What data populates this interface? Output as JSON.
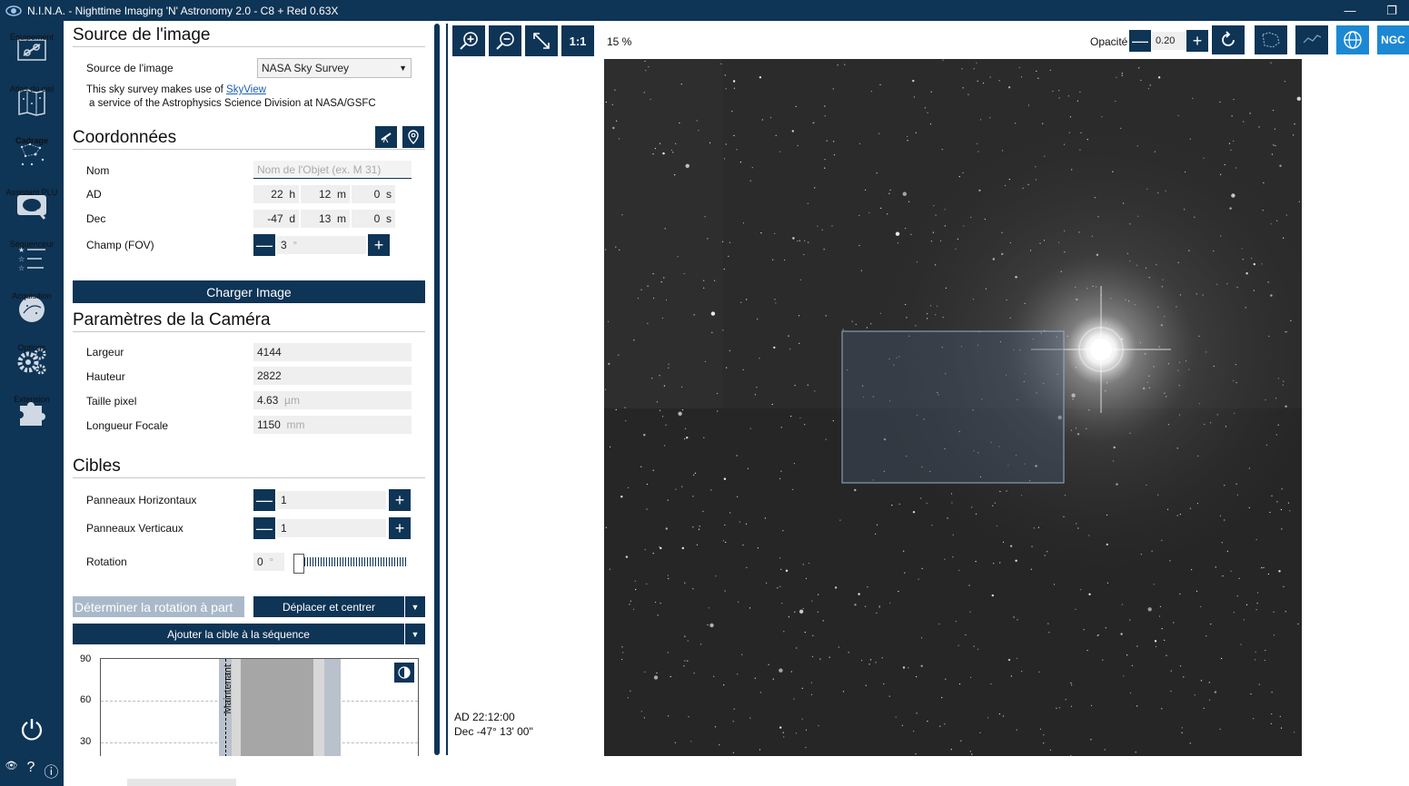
{
  "window": {
    "title": "N.I.N.A. - Nighttime Imaging 'N' Astronomy 2.0   -  C8 + Red 0.63X",
    "minimize": "—",
    "maximize": "❐"
  },
  "sidebar": {
    "items": [
      {
        "label": "Équipement",
        "icon": "equipment-icon"
      },
      {
        "label": "Atlas du ciel",
        "icon": "sky-atlas-icon"
      },
      {
        "label": "Cadrage",
        "icon": "framing-icon",
        "active": true
      },
      {
        "label": "Assistant PLU",
        "icon": "flat-wizard-icon"
      },
      {
        "label": "Séquenceur",
        "icon": "sequencer-icon"
      },
      {
        "label": "Acquisition",
        "icon": "imaging-icon"
      },
      {
        "label": "Options",
        "icon": "gears-icon"
      },
      {
        "label": "Extension",
        "icon": "puzzle-icon"
      }
    ],
    "power_glyph": "⏻",
    "help_glyph": "?",
    "info_glyph": "ⓘ",
    "eye_glyph": "👁"
  },
  "image_source": {
    "heading": "Source de l'image",
    "label": "Source de l'image",
    "selected": "NASA Sky Survey",
    "credit_prefix": "This sky survey makes use of ",
    "credit_link": "SkyView",
    "credit_suffix": "a service of the Astrophysics Science Division at NASA/GSFC"
  },
  "coordinates": {
    "heading": "Coordonnées",
    "name_label": "Nom",
    "name_placeholder": "Nom de l'Objet (ex. M 31)",
    "ra_label": "AD",
    "ra_h": "22",
    "ra_h_unit": "h",
    "ra_m": "12",
    "ra_m_unit": "m",
    "ra_s": "0",
    "ra_s_unit": "s",
    "dec_label": "Dec",
    "dec_d": "-47",
    "dec_d_unit": "d",
    "dec_m": "13",
    "dec_m_unit": "m",
    "dec_s": "0",
    "dec_s_unit": "s",
    "fov_label": "Champ (FOV)",
    "fov_value": "3",
    "fov_unit": "°",
    "load_button": "Charger Image"
  },
  "camera": {
    "heading": "Paramètres de la Caméra",
    "width_label": "Largeur",
    "width_value": "4144",
    "height_label": "Hauteur",
    "height_value": "2822",
    "pixel_label": "Taille pixel",
    "pixel_value": "4.63",
    "pixel_unit": "µm",
    "focal_label": "Longueur Focale",
    "focal_value": "1150",
    "focal_unit": "mm"
  },
  "targets": {
    "heading": "Cibles",
    "hpanels_label": "Panneaux Horizontaux",
    "hpanels_value": "1",
    "vpanels_label": "Panneaux Verticaux",
    "vpanels_value": "1",
    "rotation_label": "Rotation",
    "rotation_value": "0",
    "rotation_unit": "°",
    "rotation_fraction": 0.0,
    "determine_rotation": "Déterminer la rotation à part",
    "slew_center": "Déplacer et centrer",
    "add_to_sequence": "Ajouter la cible à la séquence"
  },
  "altitude_chart": {
    "y_ticks": [
      "90",
      "60",
      "30"
    ],
    "now_label": "Maintenant"
  },
  "image_toolbar": {
    "zoom_percent": "15 %",
    "one_to_one": "1:1",
    "opacity_label": "Opacité",
    "opacity_value": "0.20",
    "ngc_label": "NGC"
  },
  "image_overlay": {
    "ra_text": "AD  22:12:00",
    "dec_text": "Dec  -47° 13' 00\""
  }
}
